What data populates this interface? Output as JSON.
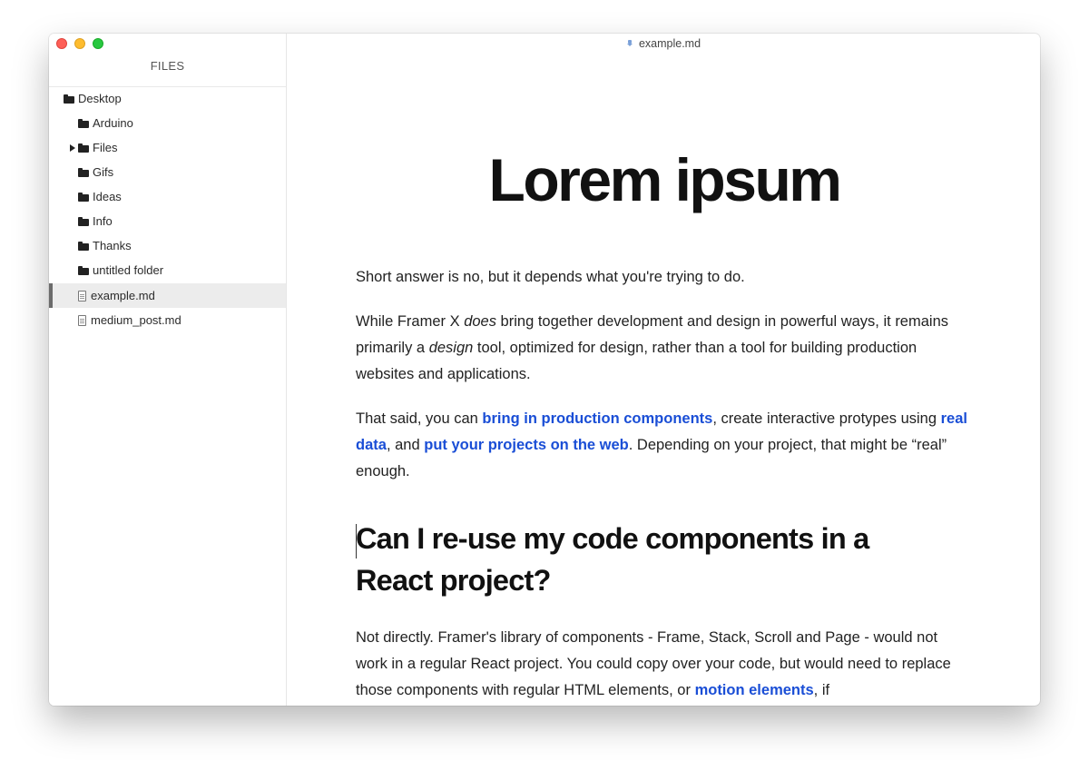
{
  "window": {
    "title": "example.md"
  },
  "sidebar": {
    "title": "FILES",
    "items": [
      {
        "label": "Desktop",
        "type": "folder"
      },
      {
        "label": "Arduino",
        "type": "folder"
      },
      {
        "label": "Files",
        "type": "folder",
        "collapsed": true
      },
      {
        "label": "Gifs",
        "type": "folder"
      },
      {
        "label": "Ideas",
        "type": "folder"
      },
      {
        "label": "Info",
        "type": "folder"
      },
      {
        "label": "Thanks",
        "type": "folder"
      },
      {
        "label": "untitled folder",
        "type": "folder"
      },
      {
        "label": "example.md",
        "type": "file",
        "selected": true
      },
      {
        "label": "medium_post.md",
        "type": "file"
      }
    ]
  },
  "document": {
    "heading": "Lorem ipsum",
    "p1": "Short answer is no, but it depends what you're trying to do.",
    "p2": {
      "t1": "While Framer X ",
      "em1": "does",
      "t2": " bring together development and design in powerful ways, it remains primarily a ",
      "em2": "design",
      "t3": " tool, optimized for design, rather than a tool for building production websites and applications."
    },
    "p3": {
      "t1": "That said, you can ",
      "link1": "bring in production components",
      "t2": ", create interactive protypes using ",
      "link2": "real data",
      "t3": ", and ",
      "link3": "put your projects on the web",
      "t4": ". Depending on your project, that might be “real” enough."
    },
    "subheading": "Can I re-use my code components in a React project?",
    "p4": {
      "t1": "Not directly. Framer's library of components - Frame, Stack, Scroll and Page - would not work in a regular React project. You could copy over your code, but would need to replace those components with regular HTML elements, or ",
      "link1": "motion elements",
      "t2": ", if"
    }
  }
}
